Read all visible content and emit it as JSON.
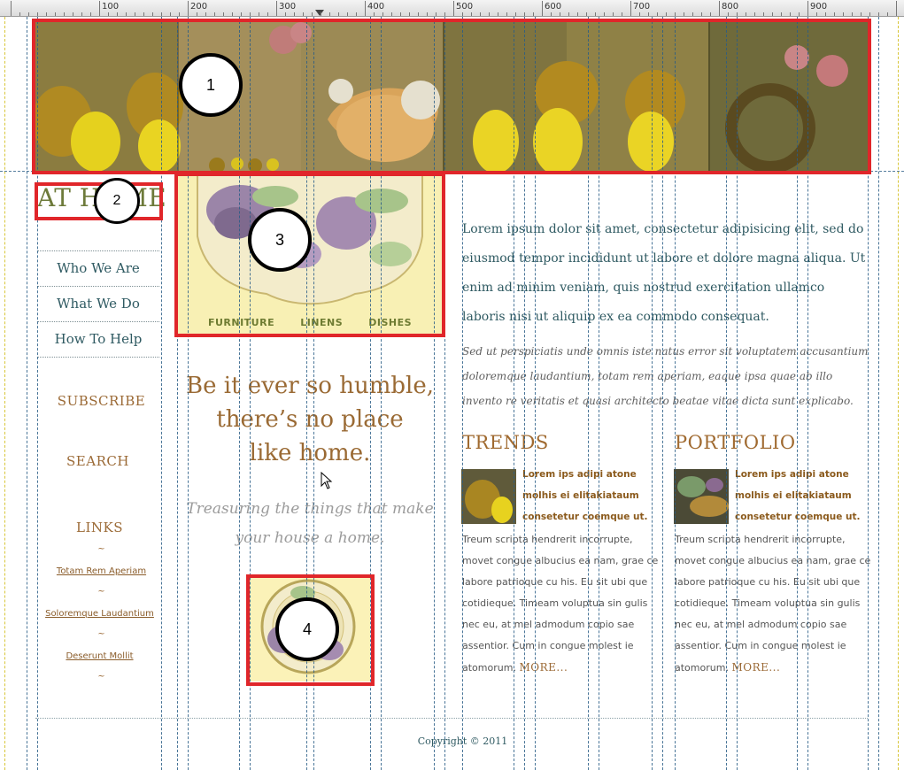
{
  "ruler": {
    "labels": [
      "100",
      "200",
      "300",
      "400",
      "500",
      "600",
      "700",
      "800",
      "900"
    ]
  },
  "annotations": [
    {
      "number": "1",
      "target": "header-banner"
    },
    {
      "number": "2",
      "target": "logo"
    },
    {
      "number": "3",
      "target": "feature-plate"
    },
    {
      "number": "4",
      "target": "small-plate"
    }
  ],
  "header": {
    "logo_text": "AT HOME"
  },
  "nav": {
    "items": [
      "Who We Are",
      "What We Do",
      "How To Help"
    ]
  },
  "sidebar": {
    "subscribe": "SUBSCRIBE",
    "search": "SEARCH",
    "links_heading": "LINKS",
    "separator": "~",
    "links": [
      "Totam Rem Aperiam",
      "Soloremque Laudantium",
      "Deserunt Mollit "
    ]
  },
  "feature": {
    "menu": [
      "FURNITURE",
      "LINENS",
      "DISHES"
    ]
  },
  "tagline": {
    "lines": [
      "Be it ever so humble,",
      "there’s no place",
      "like home."
    ],
    "sub_lines": [
      "Treasuring the things that make",
      "your house a home."
    ]
  },
  "intro": {
    "paragraph": "Lorem ipsum dolor sit amet, consectetur adipisicing elit, sed do eiusmod tempor incididunt ut labore et dolore magna aliqua. Ut enim ad minim veniam, quis nostrud exercitation ullamco laboris nisi ut aliquip ex ea commodo consequat.",
    "italic": "Sed ut perspiciatis unde omnis iste natus error sit voluptatem accusantium doloremque laudantium, totam rem aperiam, eaque ipsa quae ab illo invento re veritatis et quasi architecto beatae vitae dicta sunt explicabo."
  },
  "columns": [
    {
      "title": "TRENDS",
      "bold": "Lorem ips adipi atone molhis ei elitakiataum consetetur coemque ut.",
      "body": "Treum scripta hendrerit incorrupte, movet congue albucius ea nam, grae ce labore patrioque cu his. Eu sit ubi que cotidieque. Timeam voluptua sin gulis nec eu, at mel admodum copio sae assentior. Cum in congue molest ie atomorum.",
      "more": "MORE..."
    },
    {
      "title": "PORTFOLIO",
      "bold": "Lorem ips adipi atone molhis ei elitakiataum consetetur coemque ut.",
      "body": "Treum scripta hendrerit incorrupte, movet congue albucius ea nam, grae ce labore patrioque cu his. Eu sit ubi que cotidieque. Timeam voluptua sin gulis nec eu, at mel admodum copio sae assentior. Cum in congue molest ie atomorum.",
      "more": "MORE..."
    }
  ],
  "footer": {
    "copyright": "Copyright © 2011"
  },
  "colors": {
    "highlight": "#e0262a",
    "heading": "#9a6a34",
    "nav_text": "#2f5a62",
    "logo": "#6d7a3a",
    "plate_bg": "#f8f0b4"
  },
  "icons": [
    "pointer-cursor-icon",
    "ruler-marker-icon"
  ]
}
